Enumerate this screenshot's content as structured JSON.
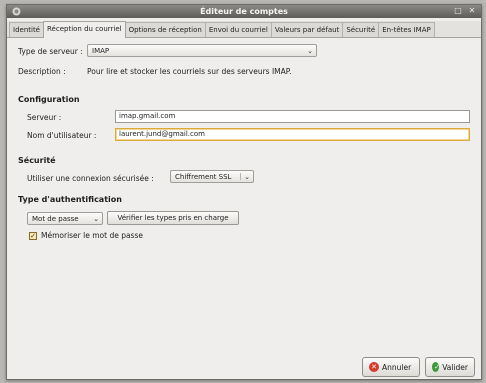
{
  "window": {
    "title": "Éditeur de comptes"
  },
  "tabs": [
    {
      "label": "Identité"
    },
    {
      "label": "Réception du courriel",
      "active": true
    },
    {
      "label": "Options de réception"
    },
    {
      "label": "Envoi du courriel"
    },
    {
      "label": "Valeurs par défaut"
    },
    {
      "label": "Sécurité"
    },
    {
      "label": "En-têtes IMAP"
    }
  ],
  "server_type": {
    "label": "Type de serveur :",
    "value": "IMAP",
    "description_label": "Description :",
    "description": "Pour lire et stocker les courriels sur des serveurs IMAP."
  },
  "configuration": {
    "heading": "Configuration",
    "server_label": "Serveur :",
    "server_value": "imap.gmail.com",
    "username_label": "Nom d'utilisateur :",
    "username_value": "laurent.jund@gmail.com"
  },
  "security": {
    "heading": "Sécurité",
    "secure_label": "Utiliser une connexion sécurisée :",
    "secure_value": "Chiffrement SSL"
  },
  "auth": {
    "heading": "Type d'authentification",
    "method_value": "Mot de passe",
    "check_types_button": "Vérifier les types pris en charge",
    "remember_label": "Mémoriser le mot de passe",
    "remember_checked": true
  },
  "actions": {
    "cancel_label": "Annuler",
    "ok_label": "Valider"
  },
  "colors": {
    "titlebar": "#6e6d69",
    "focus_border": "#d8ab3c",
    "cancel_icon": "#d23c2c",
    "ok_icon": "#3f9a3a"
  }
}
